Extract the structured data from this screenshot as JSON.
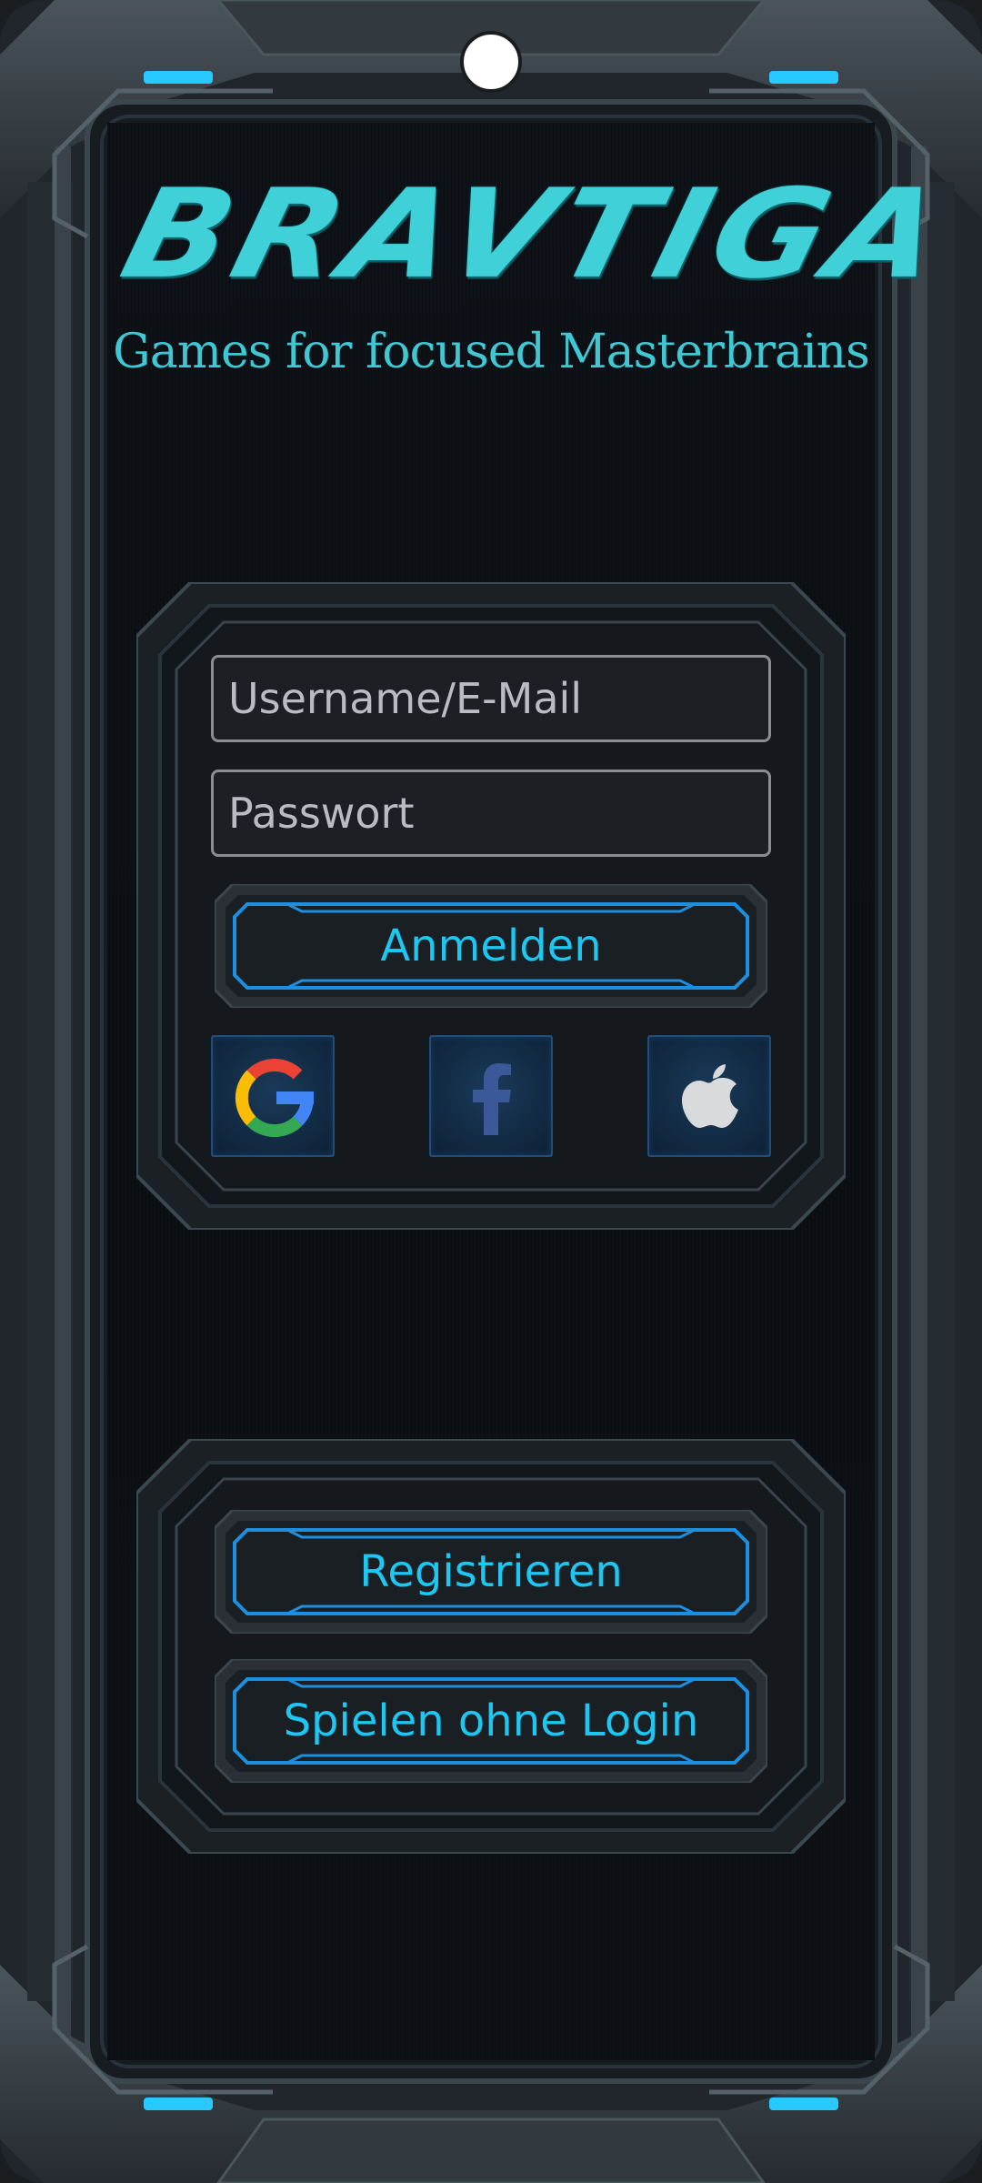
{
  "app": {
    "title": "BRAVTIGA",
    "subtitle": "Games for focused Masterbrains"
  },
  "login": {
    "username_placeholder": "Username/E-Mail",
    "password_placeholder": "Passwort",
    "submit_label": "Anmelden",
    "social": [
      {
        "name": "google",
        "icon": "google-icon"
      },
      {
        "name": "facebook",
        "icon": "facebook-icon"
      },
      {
        "name": "apple",
        "icon": "apple-icon"
      }
    ]
  },
  "secondary": {
    "register_label": "Registrieren",
    "guest_label": "Spielen ohne Login"
  },
  "colors": {
    "accent": "#1ec6f2",
    "title": "#3fd0d8",
    "frame": "#2b3339",
    "background": "#0b0f13"
  }
}
